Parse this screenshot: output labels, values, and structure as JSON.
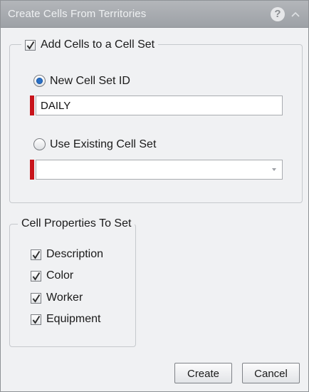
{
  "window": {
    "title": "Create Cells From Territories",
    "help_icon": "?"
  },
  "add_cells": {
    "checkbox_label": "Add Cells to a Cell Set",
    "checked": true,
    "new_set": {
      "label": "New Cell Set ID",
      "selected": true,
      "value": "DAILY"
    },
    "existing_set": {
      "label": "Use Existing Cell Set",
      "selected": false,
      "value": ""
    }
  },
  "properties": {
    "title": "Cell Properties To Set",
    "items": [
      {
        "label": "Description",
        "checked": true
      },
      {
        "label": "Color",
        "checked": true
      },
      {
        "label": "Worker",
        "checked": true
      },
      {
        "label": "Equipment",
        "checked": true
      }
    ]
  },
  "buttons": {
    "create": "Create",
    "cancel": "Cancel"
  },
  "colors": {
    "required_marker": "#c8141b",
    "radio_selected": "#2a6fc4"
  }
}
